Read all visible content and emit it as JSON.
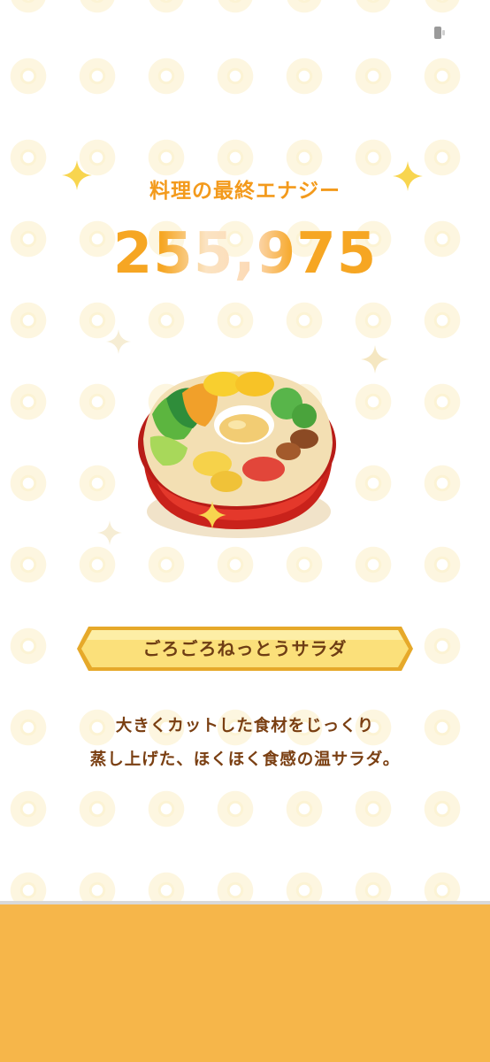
{
  "result": {
    "energy_label": "料理の最終エナジー",
    "energy_value": "255,975"
  },
  "dish": {
    "name": "ごろごろねっとうサラダ",
    "description_line1": "大きくカットした食材をじっくり",
    "description_line2": "蒸し上げた、ほくほく食感の温サラダ。"
  },
  "colors": {
    "accent_orange": "#f39a1c",
    "text_brown": "#7a3f12",
    "banner_yellow": "#f9da6a",
    "bottom_panel": "#f6b64a"
  },
  "icons": [
    "sparkle-icon",
    "status-icon"
  ]
}
